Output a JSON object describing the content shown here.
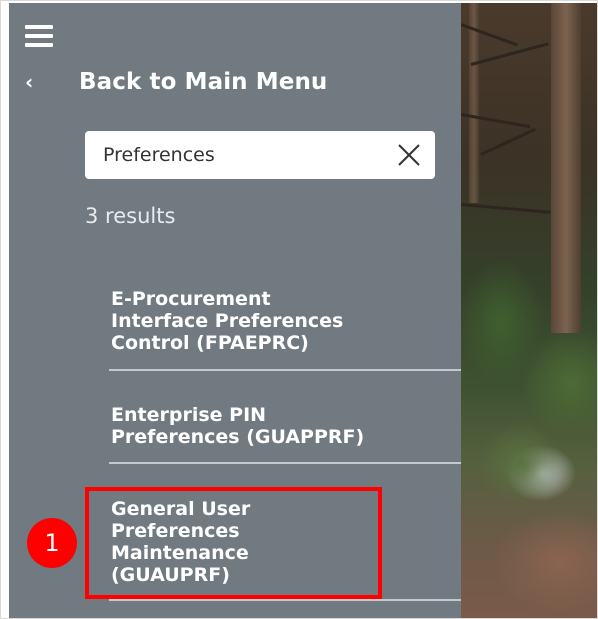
{
  "menu": {
    "menu_icon": "hamburger-menu-icon",
    "back_icon": "chevron-left-icon",
    "back_label": "Back to Main Menu"
  },
  "search": {
    "value": "Preferences",
    "clear_icon": "close-icon"
  },
  "results": {
    "count_label": "3 results",
    "items": [
      {
        "lines": [
          "E-Procurement",
          "Interface Preferences",
          "Control (FPAEPRC)"
        ]
      },
      {
        "lines": [
          "Enterprise PIN",
          "Preferences (GUAPPRF)"
        ]
      },
      {
        "lines": [
          "General User",
          "Preferences",
          "Maintenance",
          "(GUAUPRF)"
        ]
      }
    ]
  },
  "annotation": {
    "step_number": "1",
    "highlight_color": "#ff0000"
  },
  "colors": {
    "sidebar_bg": "#707a80",
    "text": "#ffffff",
    "divider": "#c4c9cc"
  }
}
